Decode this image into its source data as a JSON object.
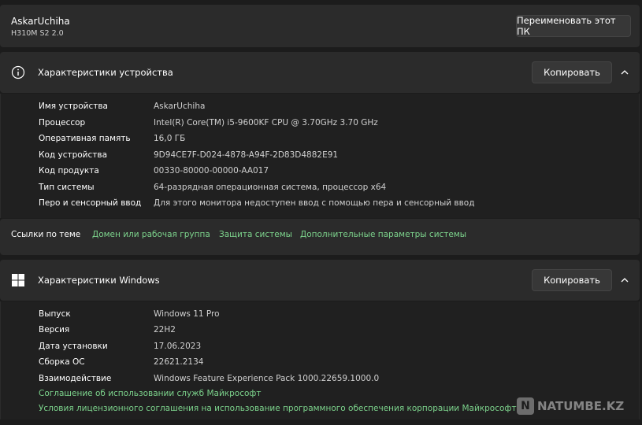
{
  "pc": {
    "name": "AskarUchiha",
    "model": "H310M S2 2.0",
    "rename_label": "Переименовать этот ПК"
  },
  "device_specs": {
    "title": "Характеристики устройства",
    "copy_label": "Копировать",
    "rows": [
      {
        "label": "Имя устройства",
        "value": "AskarUchiha"
      },
      {
        "label": "Процессор",
        "value": "Intel(R) Core(TM) i5-9600KF CPU @ 3.70GHz   3.70 GHz"
      },
      {
        "label": "Оперативная память",
        "value": "16,0 ГБ"
      },
      {
        "label": "Код устройства",
        "value": "9D94CE7F-D024-4878-A94F-2D83D4882E91"
      },
      {
        "label": "Код продукта",
        "value": "00330-80000-00000-AA017"
      },
      {
        "label": "Тип системы",
        "value": "64-разрядная операционная система, процессор x64"
      },
      {
        "label": "Перо и сенсорный ввод",
        "value": "Для этого монитора недоступен ввод с помощью пера и сенсорный ввод"
      }
    ]
  },
  "related": {
    "label": "Ссылки по теме",
    "links": [
      "Домен или рабочая группа",
      "Защита системы",
      "Дополнительные параметры системы"
    ]
  },
  "windows_specs": {
    "title": "Характеристики Windows",
    "copy_label": "Копировать",
    "rows": [
      {
        "label": "Выпуск",
        "value": "Windows 11 Pro"
      },
      {
        "label": "Версия",
        "value": "22H2"
      },
      {
        "label": "Дата установки",
        "value": "17.06.2023"
      },
      {
        "label": "Сборка ОС",
        "value": "22621.2134"
      },
      {
        "label": "Взаимодействие",
        "value": "Windows Feature Experience Pack 1000.22659.1000.0"
      }
    ],
    "links": [
      "Соглашение об использовании служб Майкрософт",
      "Условия лицензионного соглашения на использование программного обеспечения корпорации Майкрософт"
    ]
  },
  "watermark": {
    "logo_letter": "N",
    "text": "NATUMBE.KZ"
  },
  "colors": {
    "accent_link": "#7cd38c",
    "card_bg": "#2b2b2b",
    "page_bg": "#1c1c1c"
  }
}
